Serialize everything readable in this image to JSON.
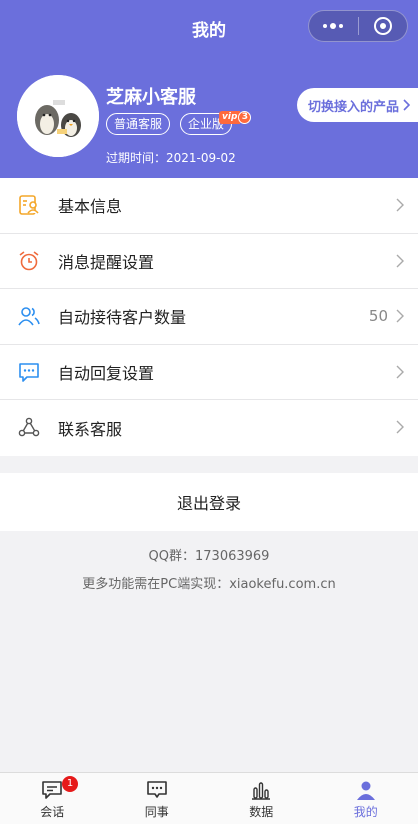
{
  "nav": {
    "title": "我的"
  },
  "profile": {
    "name": "芝麻小客服",
    "tags": [
      "普通客服",
      "企业版"
    ],
    "vip_label": "vip",
    "vip_level": "3",
    "expire": "过期时间：2021-09-02",
    "switch_button": "切换接入的产品"
  },
  "menu": {
    "items": [
      {
        "label": "基本信息",
        "icon": "profile-card-icon",
        "color": "#f4a72a"
      },
      {
        "label": "消息提醒设置",
        "icon": "alarm-clock-icon",
        "color": "#ef6a3c"
      },
      {
        "label": "自动接待客户数量",
        "icon": "users-icon",
        "color": "#2c8ff0",
        "value": "50"
      },
      {
        "label": "自动回复设置",
        "icon": "chat-bubble-icon",
        "color": "#2c8ff0"
      },
      {
        "label": "联系客服",
        "icon": "share-nodes-icon",
        "color": "#555555"
      }
    ]
  },
  "logout": {
    "label": "退出登录"
  },
  "footer": {
    "qq": "QQ群：173063969",
    "pc_note": "更多功能需在PC端实现：xiaokefu.com.cn"
  },
  "tabbar": {
    "tabs": [
      {
        "label": "会话",
        "icon": "conversation-icon",
        "badge": "1"
      },
      {
        "label": "同事",
        "icon": "colleague-chat-icon"
      },
      {
        "label": "数据",
        "icon": "bar-stats-icon"
      },
      {
        "label": "我的",
        "icon": "person-icon",
        "active": true
      }
    ]
  },
  "colors": {
    "accent": "#6b6fdc",
    "badge": "#e61a1a"
  }
}
